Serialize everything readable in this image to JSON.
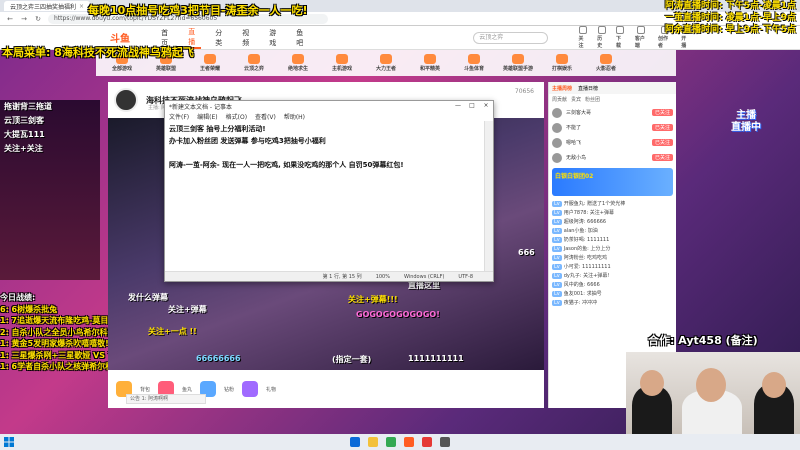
{
  "browser": {
    "tab_title": "云顶之弈三四抽奖抽福利",
    "url": "https://www.douyu.com/topic/YDSYZFL2?rid=6560605"
  },
  "overlay": {
    "banner_top": "每晚10点抽号吃鸡3把节目-涛歪余一人一吃!",
    "schedule": [
      "阿涛直播时间: 下午5点-凌晨1点",
      "一茧直播时间: 凌晨1点-早上9点",
      "阿余直播时间: 早上9点-下午5点"
    ],
    "menu_title": "本局菜单: 8海科技不死流战神乌鸦起飞",
    "left_ad_lines": [
      "拖谢背三拖道",
      "云顶三剑客",
      "大提瓦111",
      "关注+关注"
    ],
    "today_header": "今日战绩:",
    "today_items": [
      "6: 6树爆杀批兔",
      "1: 7追逝爆天流布隆吃鸡-莫目斯yyds",
      "2: 自杀小队之全员小鸟希尔科傲娇",
      "1: 黄金5发明家爆杀吹嘻嘻敬! ！关注+",
      "1: 三星爆杀咧+三星歌娅 VS 7枪 专3星德莱文",
      "1: 6学者自杀小队之核弹希尔科爽爽!"
    ],
    "coop": "合作: Ayt458 (备注)"
  },
  "header": {
    "logo": "斗鱼",
    "nav": [
      "首页",
      "直播",
      "分类",
      "视频",
      "游戏",
      "鱼吧"
    ],
    "active_nav": "直播",
    "search_placeholder": "云顶之弈",
    "icons": [
      "关注",
      "历史",
      "下载",
      "客户端",
      "创作者",
      "开播"
    ]
  },
  "categories": [
    "全部游戏",
    "英雄联盟",
    "王者荣耀",
    "云顶之弈",
    "绝地求生",
    "主机游戏",
    "大力王者",
    "和平精英",
    "斗鱼体育",
    "英雄联盟手游",
    "打棋娱乐",
    "火影忍者"
  ],
  "room": {
    "title": "海科技不死流战神乌鸦起飞",
    "sub": "主播: 阿涛啊啊 · 云顶之弈 · 举报",
    "room_id": "70656"
  },
  "notepad": {
    "title": "*新建文本文档 - 记事本",
    "menu": [
      "文件(F)",
      "编辑(E)",
      "格式(O)",
      "查看(V)",
      "帮助(H)"
    ],
    "lines": [
      "云顶三剑客 抽号上分福利活动!",
      "办卡加入粉丝团 发送弹幕 参与吃鸡3把抽号小福利",
      "",
      "阿涛-一茧-阿余- 现在一人一把吃鸡, 如果没吃鸡的那个人 自罚50弹幕红包!"
    ],
    "status": [
      "第 1 行, 第 15 列",
      "100%",
      "Windows (CRLF)",
      "UTF-8"
    ]
  },
  "danmu": [
    "发什么弹幕",
    "关注+弹幕",
    "关注+弹幕!!!",
    "GOGOGOGOGOGO!",
    "66666666",
    "1111111111",
    "(指定一套)",
    "关注+一点 !!",
    "直播这里",
    "666"
  ],
  "rank_panel": {
    "tabs": [
      "主播周榜",
      "直播日榜"
    ],
    "active_tab": "主播周榜",
    "sub_tabs": [
      "周贡献",
      "贵宾",
      "粉丝团"
    ],
    "rows": [
      {
        "name": "三剑客大哥",
        "badge": "已关注"
      },
      {
        "name": "不能了",
        "badge": "已关注"
      },
      {
        "name": "嗯哈飞",
        "badge": "已关注"
      },
      {
        "name": "无敌小鸟",
        "badge": "已关注"
      }
    ],
    "vip_title": "白银白银团02",
    "chat": [
      "开服鱼丸: 赠送了1个荧光棒",
      "用户7878: 关注+弹幕",
      "超级阿涛: 666666",
      "alan小鱼: 加油",
      "奶茶好喝: 1111111",
      "Jason的鱼: 上分上分",
      "阿涛粉丝: 吃鸡吃鸡",
      "小可爱: 111111111",
      "dy丸子: 关注+弹幕!",
      "风中的鱼: 6666",
      "鱼友001: 求抽号",
      "夜猫子: 冲冲冲"
    ]
  },
  "footer": {
    "rank_label": "公告 1: 阿涛啊啊",
    "labels": [
      "背包",
      "鱼丸",
      "钻粉",
      "礼物"
    ]
  },
  "live_badge": "主播\n直播中",
  "colors": {
    "accent": "#ff5d23",
    "yellow": "#ffe100",
    "bg": "#7a2a8c"
  }
}
